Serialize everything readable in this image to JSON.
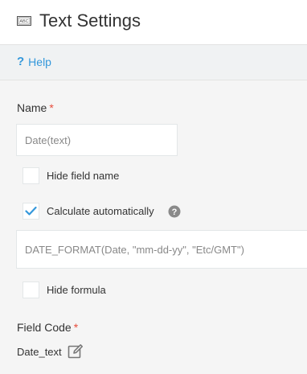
{
  "header": {
    "icon": "text-field-icon",
    "title": "Text Settings"
  },
  "help": {
    "icon": "question-mark-icon",
    "label": "Help",
    "color": "#3498db"
  },
  "name_field": {
    "label": "Name",
    "required_marker": "*",
    "value": "Date(text)"
  },
  "options": {
    "hide_field_name": {
      "label": "Hide field name",
      "checked": false
    },
    "calculate_automatically": {
      "label": "Calculate automatically",
      "checked": true,
      "info_icon": "question-circle-icon"
    }
  },
  "formula": {
    "value": "DATE_FORMAT(Date, \"mm-dd-yy\", \"Etc/GMT\")"
  },
  "hide_formula": {
    "label": "Hide formula",
    "checked": false
  },
  "field_code": {
    "label": "Field Code",
    "required_marker": "*",
    "value": "Date_text",
    "edit_icon": "pencil-edit-icon"
  },
  "colors": {
    "accent": "#3498db",
    "required": "#e74c3c",
    "checkmark": "#3498db"
  }
}
